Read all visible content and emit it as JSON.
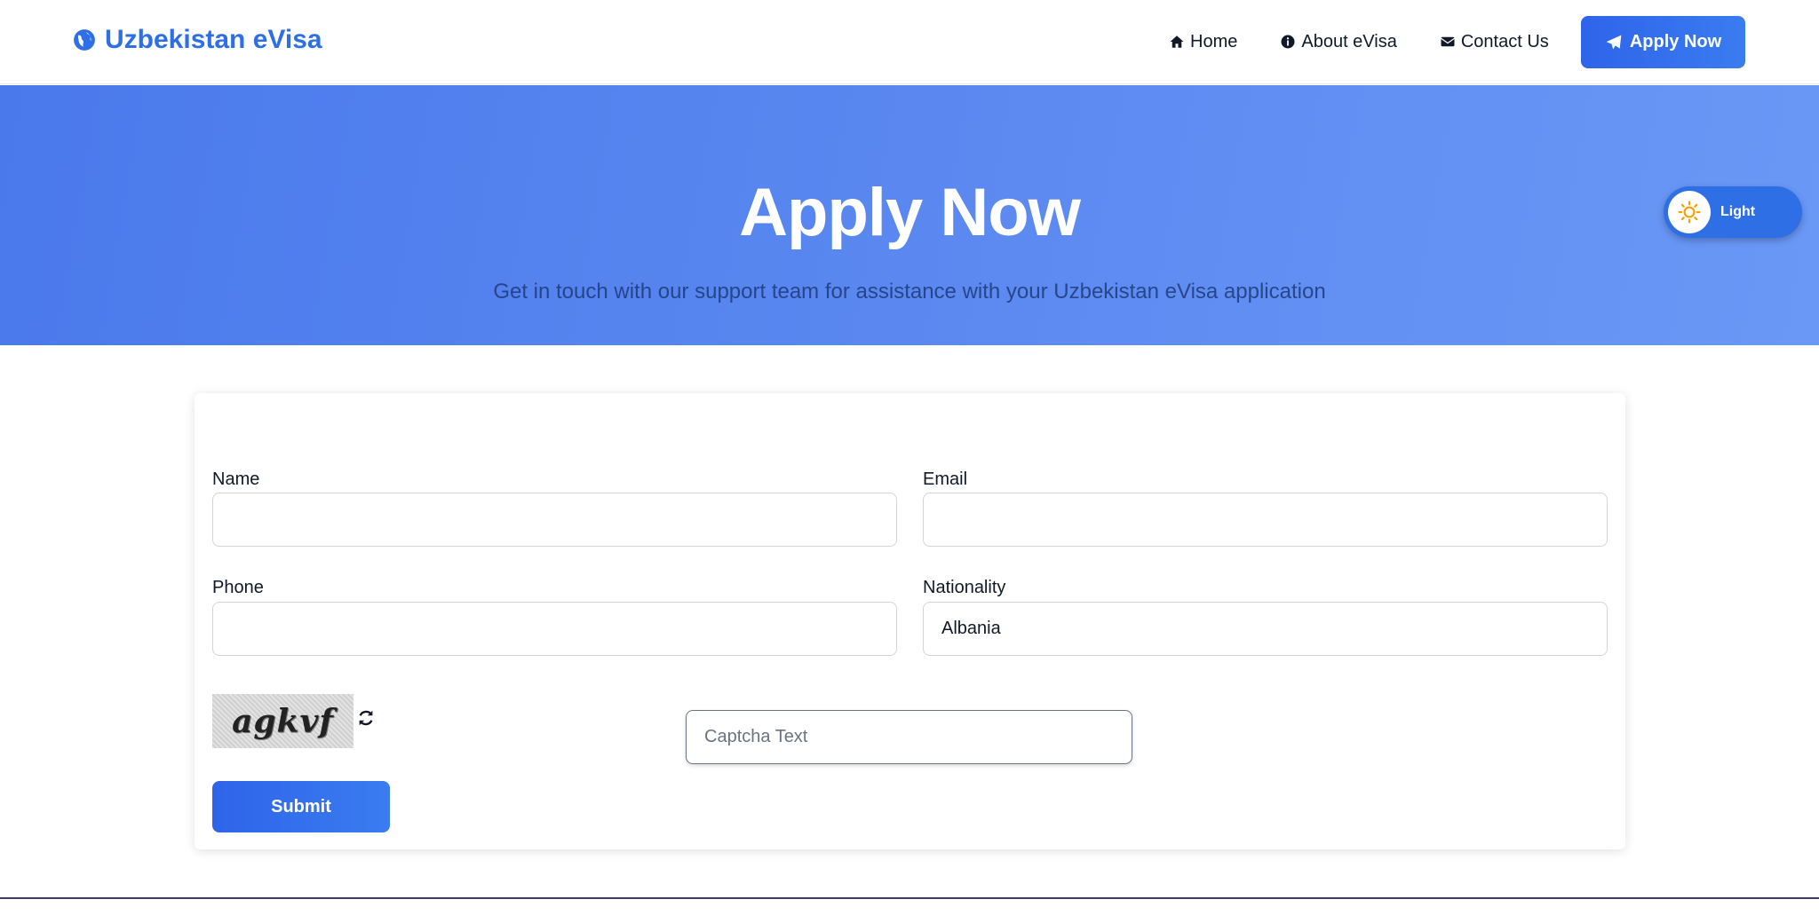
{
  "header": {
    "brand": "Uzbekistan eVisa",
    "nav": {
      "home": "Home",
      "about": "About eVisa",
      "contact": "Contact Us"
    },
    "apply_label": "Apply Now"
  },
  "hero": {
    "title": "Apply Now",
    "subtitle": "Get in touch with our support team for assistance with your Uzbekistan eVisa application",
    "theme_toggle_label": "Light"
  },
  "form": {
    "name_label": "Name",
    "name_value": "",
    "email_label": "Email",
    "email_value": "",
    "phone_label": "Phone",
    "phone_value": "",
    "nationality_label": "Nationality",
    "nationality_value": "Albania",
    "captcha_image_text": "agkvf",
    "captcha_placeholder": "Captcha Text",
    "submit_label": "Submit"
  },
  "colors": {
    "brand": "#2f6fe6",
    "hero_start": "#4a79ec",
    "hero_end": "#6a98f6",
    "button": "#2e64ea"
  },
  "icons": {
    "brand": "globe-icon",
    "home": "home-icon",
    "about": "info-icon",
    "contact": "envelope-icon",
    "apply": "paper-plane-icon",
    "toggle": "sun-icon",
    "refresh": "refresh-icon"
  }
}
